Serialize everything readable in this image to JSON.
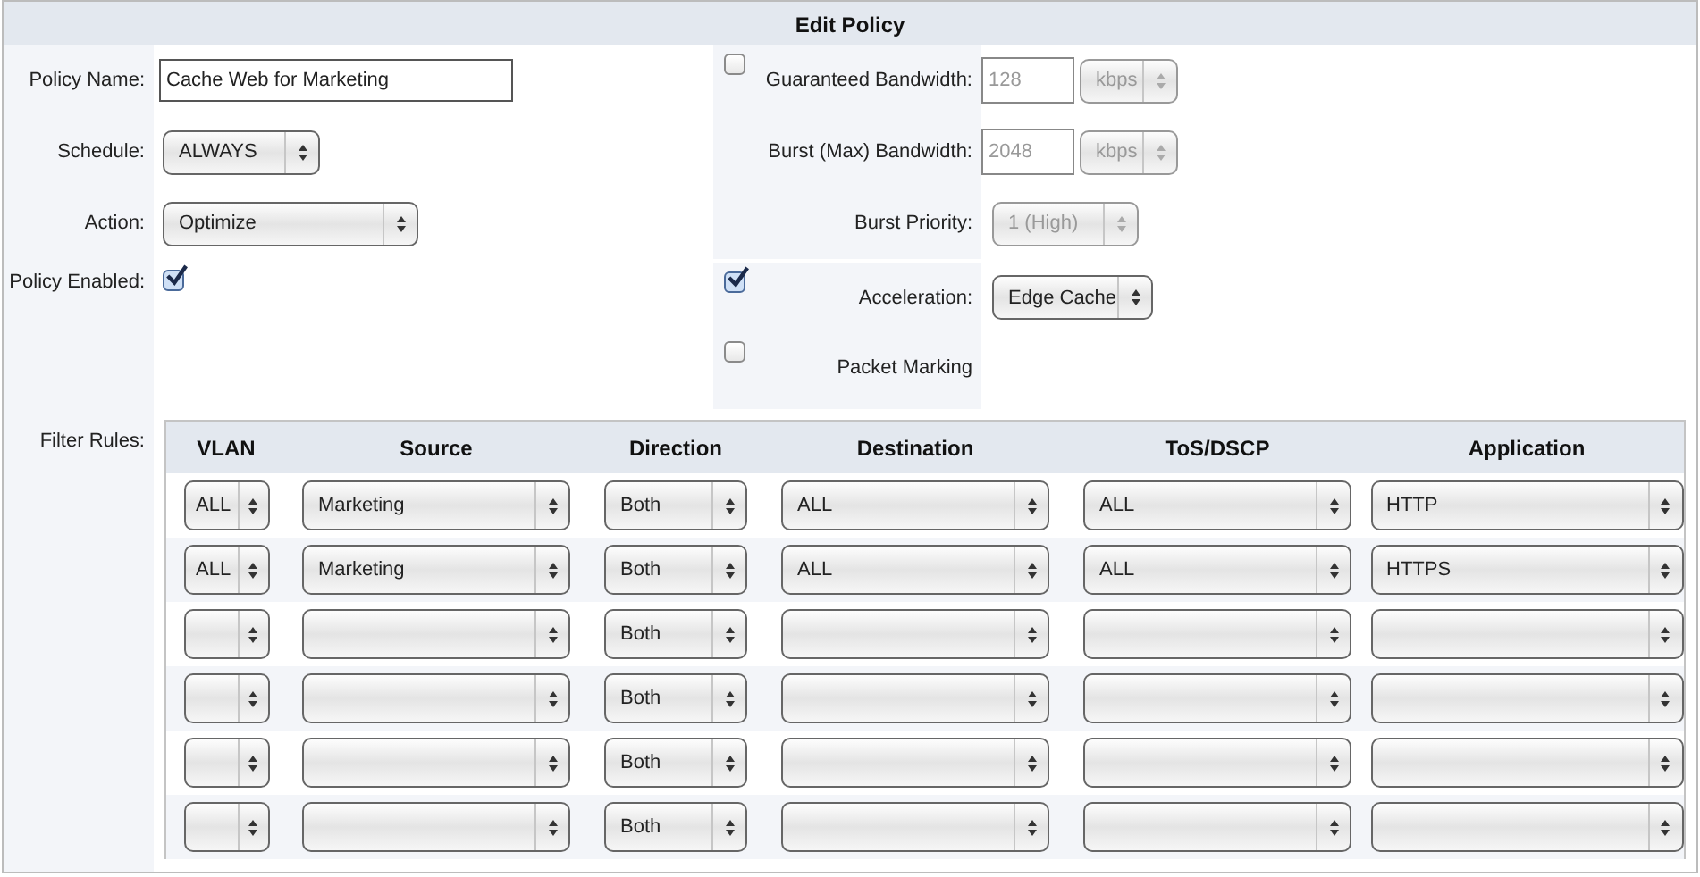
{
  "title": "Edit Policy",
  "left_fields": [
    {
      "kind": "text",
      "label": "Policy Name:",
      "value": "Cache Web for Marketing"
    },
    {
      "kind": "select",
      "label": "Schedule:",
      "value": "ALWAYS"
    },
    {
      "kind": "select",
      "label": "Action:",
      "value": "Optimize"
    },
    {
      "kind": "checkbox",
      "label": "Policy Enabled:",
      "checked": true
    }
  ],
  "right_sections": [
    [
      {
        "kind": "bandwidth",
        "label": "Guaranteed Bandwidth:",
        "checked": false,
        "value": "128",
        "unit": "kbps",
        "disabled": true
      },
      {
        "kind": "bandwidth",
        "label": "Burst (Max) Bandwidth:",
        "value": "2048",
        "unit": "kbps",
        "disabled": true
      },
      {
        "kind": "select",
        "label": "Burst Priority:",
        "value": "1 (High)",
        "disabled": true
      }
    ],
    [
      {
        "kind": "select",
        "label": "Acceleration:",
        "checked": true,
        "value": "Edge Cache",
        "disabled": false
      },
      {
        "kind": "checkbox",
        "label": "Packet Marking",
        "checked": false
      }
    ]
  ],
  "filter_rules": {
    "label": "Filter Rules:",
    "columns": [
      "VLAN",
      "Source",
      "Direction",
      "Destination",
      "ToS/DSCP",
      "Application"
    ],
    "rows": [
      {
        "cells": [
          "ALL",
          "Marketing",
          "Both",
          "ALL",
          "ALL",
          "HTTP"
        ]
      },
      {
        "cells": [
          "ALL",
          "Marketing",
          "Both",
          "ALL",
          "ALL",
          "HTTPS"
        ]
      },
      {
        "cells": [
          null,
          null,
          "Both",
          null,
          null,
          null
        ]
      },
      {
        "cells": [
          null,
          null,
          "Both",
          null,
          null,
          null
        ]
      },
      {
        "cells": [
          null,
          null,
          "Both",
          null,
          null,
          null
        ]
      },
      {
        "cells": [
          null,
          null,
          "Both",
          null,
          null,
          null
        ]
      }
    ]
  }
}
